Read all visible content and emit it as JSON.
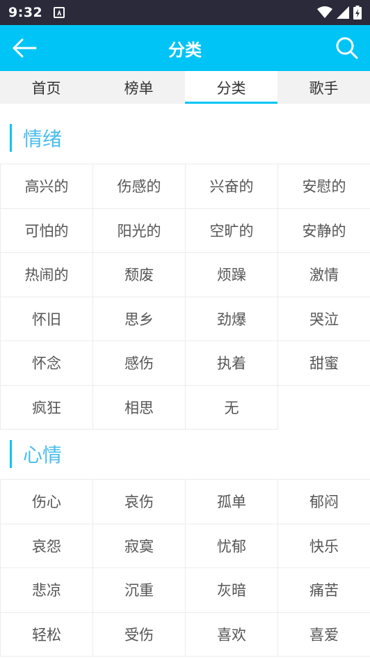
{
  "status_bar": {
    "time": "9:32"
  },
  "app_bar": {
    "title": "分类"
  },
  "tabs": [
    "首页",
    "榜单",
    "分类",
    "歌手"
  ],
  "sections": [
    {
      "title": "情绪",
      "items": [
        "高兴的",
        "伤感的",
        "兴奋的",
        "安慰的",
        "可怕的",
        "阳光的",
        "空旷的",
        "安静的",
        "热闹的",
        "颓废",
        "烦躁",
        "激情",
        "怀旧",
        "思乡",
        "劲爆",
        "哭泣",
        "怀念",
        "感伤",
        "执着",
        "甜蜜",
        "疯狂",
        "相思",
        "无"
      ]
    },
    {
      "title": "心情",
      "items": [
        "伤心",
        "哀伤",
        "孤单",
        "郁闷",
        "哀怨",
        "寂寞",
        "忧郁",
        "快乐",
        "悲凉",
        "沉重",
        "灰暗",
        "痛苦",
        "轻松",
        "受伤",
        "喜欢",
        "喜爱"
      ]
    }
  ],
  "colors": {
    "accent": "#00c4f5",
    "section_title": "#49bdec",
    "status_bar": "#2a2a3a"
  }
}
